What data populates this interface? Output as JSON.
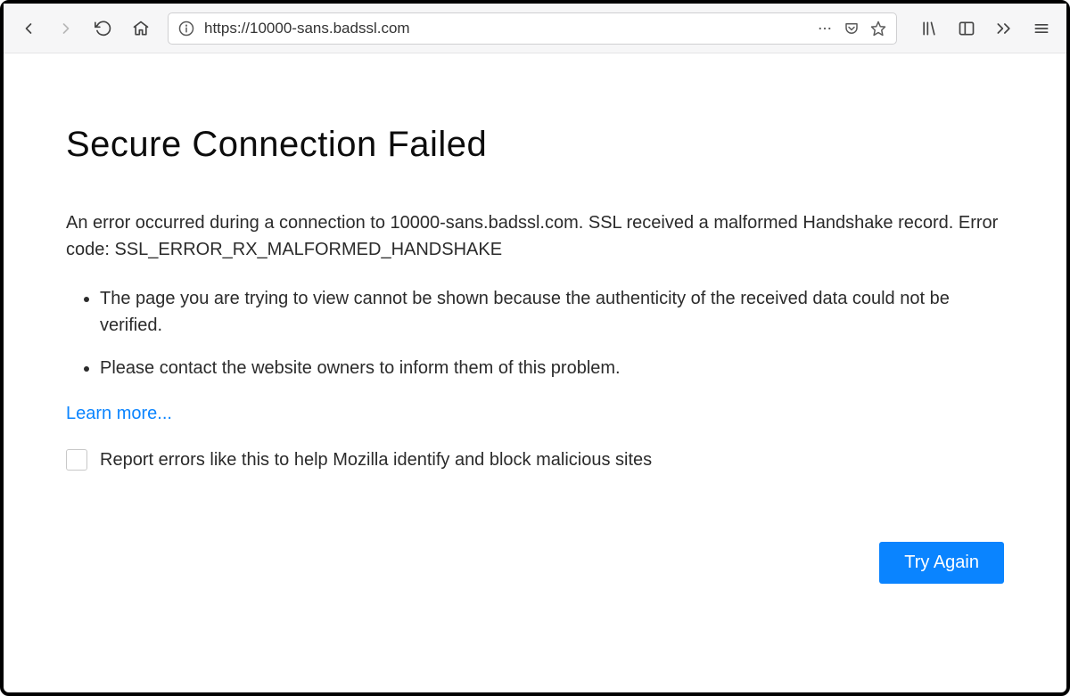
{
  "toolbar": {
    "url": "https://10000-sans.badssl.com"
  },
  "error": {
    "title": "Secure Connection Failed",
    "description": "An error occurred during a connection to 10000-sans.badssl.com. SSL received a malformed Handshake record. Error code: SSL_ERROR_RX_MALFORMED_HANDSHAKE",
    "reasons": [
      "The page you are trying to view cannot be shown because the authenticity of the received data could not be verified.",
      "Please contact the website owners to inform them of this problem."
    ],
    "learn_more": "Learn more...",
    "report_label": "Report errors like this to help Mozilla identify and block malicious sites",
    "try_again": "Try Again"
  }
}
